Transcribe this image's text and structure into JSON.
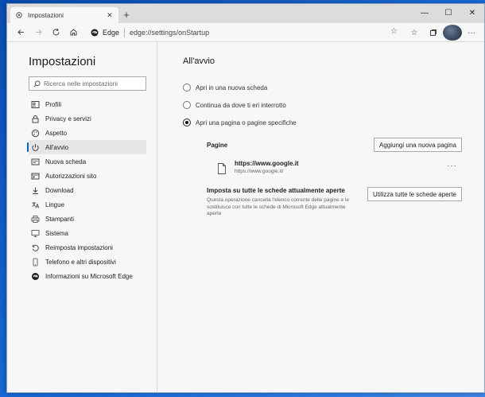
{
  "tab": {
    "title": "Impostazioni",
    "close": "✕",
    "new": "+"
  },
  "window_controls": {
    "minimize": "—",
    "maximize": "☐",
    "close": "✕"
  },
  "address": {
    "brand": "Edge",
    "url": "edge://settings/onStartup"
  },
  "sidebar": {
    "title": "Impostazioni",
    "search_placeholder": "Ricerca nelle impostazioni",
    "items": [
      {
        "label": "Profili",
        "icon": "profile-icon"
      },
      {
        "label": "Privacy e servizi",
        "icon": "lock-icon"
      },
      {
        "label": "Aspetto",
        "icon": "palette-icon"
      },
      {
        "label": "All'avvio",
        "icon": "power-icon",
        "active": true
      },
      {
        "label": "Nuova scheda",
        "icon": "newtab-icon"
      },
      {
        "label": "Autorizzazioni sito",
        "icon": "site-permissions-icon"
      },
      {
        "label": "Download",
        "icon": "download-icon"
      },
      {
        "label": "Lingue",
        "icon": "languages-icon"
      },
      {
        "label": "Stampanti",
        "icon": "printer-icon"
      },
      {
        "label": "Sistema",
        "icon": "system-icon"
      },
      {
        "label": "Reimposta impostazioni",
        "icon": "reset-icon"
      },
      {
        "label": "Telefono e altri dispositivi",
        "icon": "phone-icon"
      },
      {
        "label": "Informazioni su Microsoft Edge",
        "icon": "edge-icon"
      }
    ]
  },
  "main": {
    "title": "All'avvio",
    "options": [
      {
        "label": "Apri in una nuova scheda",
        "checked": false
      },
      {
        "label": "Continua da dove ti eri interrotto",
        "checked": false
      },
      {
        "label": "Apri una pagina o pagine specifiche",
        "checked": true
      }
    ],
    "pages_label": "Pagine",
    "add_page_button": "Aggiungi una nuova pagina",
    "page": {
      "title": "https://www.google.it",
      "url": "https://www.google.it/",
      "more": "···"
    },
    "use_all": {
      "title": "Imposta su tutte le schede attualmente aperte",
      "description": "Questa operazione cancella l'elenco corrente delle pagine e le sostituisce con tutte le schede di Microsoft Edge attualmente aperte",
      "button": "Utilizza tutte le schede aperte"
    }
  }
}
